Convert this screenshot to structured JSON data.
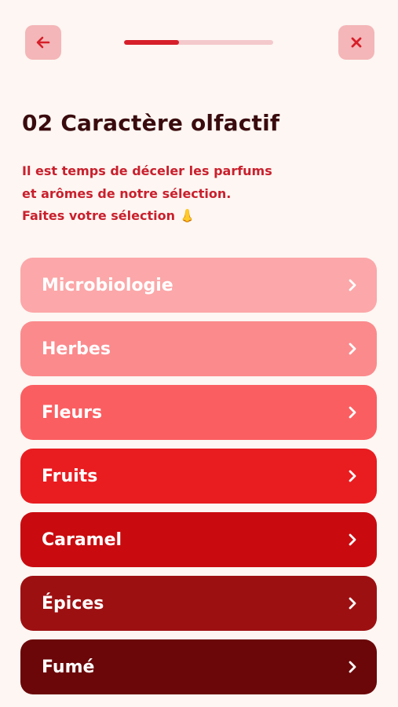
{
  "header": {
    "back_icon": "arrow-left-icon",
    "close_icon": "close-x-icon",
    "progress": 0.37,
    "colors": {
      "button_bg": "#f4b6b8",
      "icon": "#d61f2a",
      "progress_track": "#f4c9cc",
      "progress_fill": "#d61f2a"
    }
  },
  "page": {
    "title": "02 Caractère olfactif",
    "subtitle_lines": [
      "Il est temps de déceler les parfums",
      "et arômes de notre sélection.",
      "Faites votre sélection 👃"
    ]
  },
  "categories": [
    {
      "label": "Microbiologie",
      "color": "#fca7a9"
    },
    {
      "label": "Herbes",
      "color": "#fb8a8c"
    },
    {
      "label": "Fleurs",
      "color": "#fb5e61"
    },
    {
      "label": "Fruits",
      "color": "#e91c20"
    },
    {
      "label": "Caramel",
      "color": "#c90b0f"
    },
    {
      "label": "Épices",
      "color": "#9d1012"
    },
    {
      "label": "Fumé",
      "color": "#6b0709"
    }
  ],
  "chevron_icon": "chevron-right-icon"
}
